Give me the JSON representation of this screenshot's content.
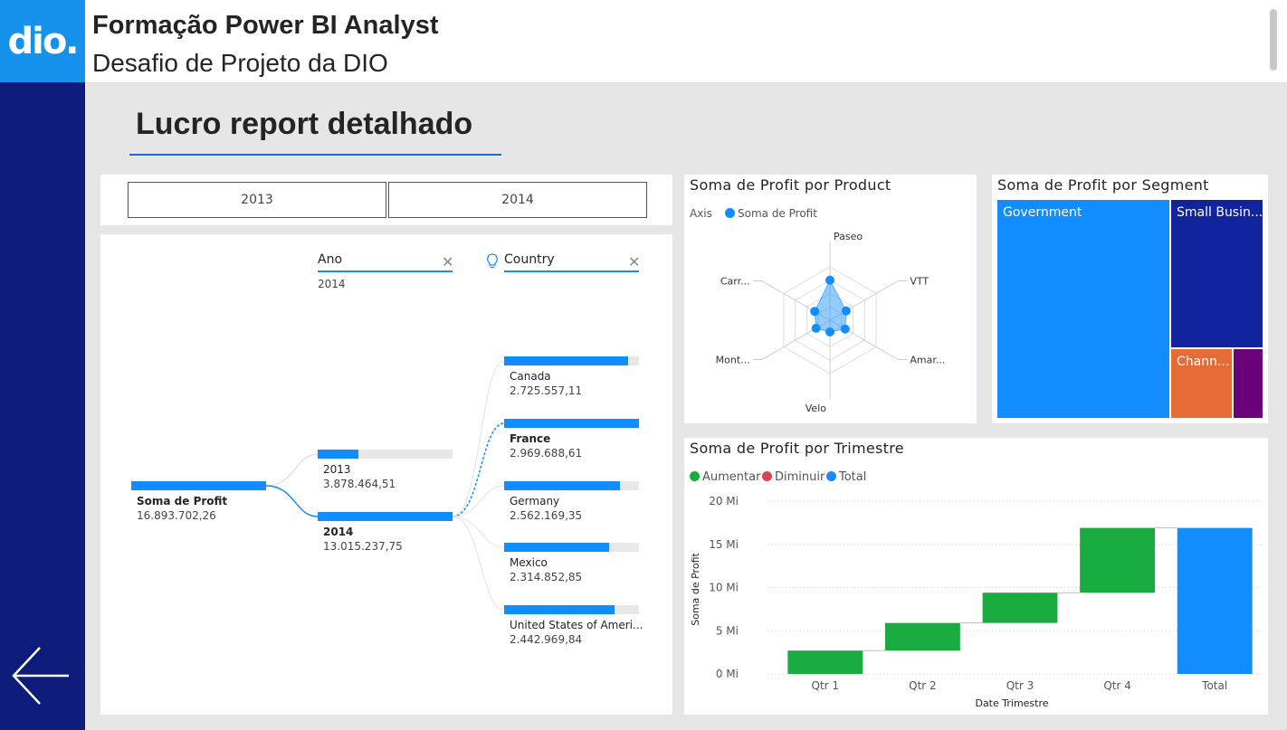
{
  "header": {
    "logo_text": "dio.",
    "title": "Formação Power BI Analyst",
    "subtitle": "Desafio de Projeto da DIO"
  },
  "page": {
    "title": "Lucro report detalhado"
  },
  "slicer": {
    "options": [
      "2013",
      "2014"
    ]
  },
  "decomp_tree": {
    "level1_header": "Ano",
    "level1_selected": "2014",
    "level2_header": "Country",
    "root": {
      "label": "Soma de Profit",
      "value": "16.893.702,26"
    },
    "years": [
      {
        "label": "2013",
        "value": "3.878.464,51",
        "fill": 0.3
      },
      {
        "label": "2014",
        "value": "13.015.237,75",
        "fill": 1.0
      }
    ],
    "countries": [
      {
        "label": "Canada",
        "value": "2.725.557,11",
        "fill": 0.92
      },
      {
        "label": "France",
        "value": "2.969.688,61",
        "fill": 1.0
      },
      {
        "label": "Germany",
        "value": "2.562.169,35",
        "fill": 0.86
      },
      {
        "label": "Mexico",
        "value": "2.314.852,85",
        "fill": 0.78
      },
      {
        "label": "United States of Ameri...",
        "value": "2.442.969,84",
        "fill": 0.82
      }
    ]
  },
  "radar": {
    "title": "Soma de Profit por Product",
    "legend_axis": "Axis",
    "legend_series": "Soma de Profit",
    "color": "#118dff",
    "chart_data": {
      "type": "radar",
      "categories": [
        "Paseo",
        "VTT",
        "Amar...",
        "Velo",
        "Mont...",
        "Carr..."
      ],
      "values": [
        0.75,
        0.35,
        0.33,
        0.22,
        0.3,
        0.33
      ]
    }
  },
  "treemap": {
    "title": "Soma de Profit por Segment",
    "cells": [
      {
        "label": "Government",
        "color": "#118dff"
      },
      {
        "label": "Small Busin...",
        "color": "#12239e"
      },
      {
        "label": "Chann...",
        "color": "#e66c37"
      },
      {
        "label": "",
        "color": "#6b007b"
      }
    ]
  },
  "waterfall": {
    "title": "Soma de Profit por Trimestre",
    "legend": [
      {
        "label": "Aumentar",
        "color": "#1aab40"
      },
      {
        "label": "Diminuir",
        "color": "#d64550"
      },
      {
        "label": "Total",
        "color": "#118dff"
      }
    ],
    "xlabel": "Date Trimestre",
    "ylabel": "Soma de Profit",
    "chart_data": {
      "type": "waterfall",
      "categories": [
        "Qtr 1",
        "Qtr 2",
        "Qtr 3",
        "Qtr 4",
        "Total"
      ],
      "values": [
        2.7,
        3.2,
        3.5,
        7.5,
        16.9
      ],
      "ylim": [
        0,
        20
      ],
      "yticks": [
        "0 Mi",
        "5 Mi",
        "10 Mi",
        "15 Mi",
        "20 Mi"
      ],
      "ytick_values": [
        0,
        5,
        10,
        15,
        20
      ]
    }
  }
}
